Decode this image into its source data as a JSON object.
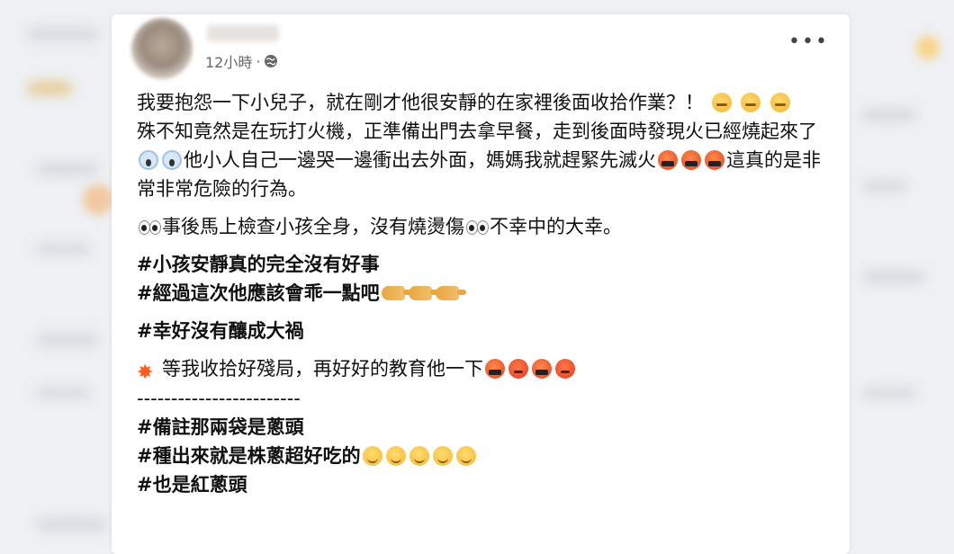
{
  "post": {
    "timestamp": "12小時",
    "separator": "·",
    "privacy_icon": "globe-icon",
    "more_label": "•••",
    "paragraphs": {
      "p1_text": "我要抱怨一下小兒子，就在剛才他很安靜的在家裡後面收拾作業？！",
      "p2_text_a": "殊不知竟然是在玩打火機，正準備出門去拿早餐，走到後面時發現火已經燒起來了",
      "p2_text_b": "他小人自己一邊哭一邊衝出去外面，媽媽我就趕緊先滅火",
      "p2_text_c": "這真的是非常非常危險的行為。",
      "p3_text_a": "事後馬上檢查小孩全身，沒有燒燙傷",
      "p3_text_b": "不幸中的大幸。",
      "tag1": "#小孩安靜真的完全沒有好事",
      "tag2": "#經過這次他應該會乖一點吧",
      "tag3": "#幸好沒有釀成大禍",
      "p4_text": "等我收拾好殘局，再好好的教育他一下",
      "divider": "------------------------",
      "tag4": "#備註那兩袋是蔥頭",
      "tag5": "#種出來就是株蔥超好吃的",
      "tag6": "#也是紅蔥頭"
    }
  }
}
